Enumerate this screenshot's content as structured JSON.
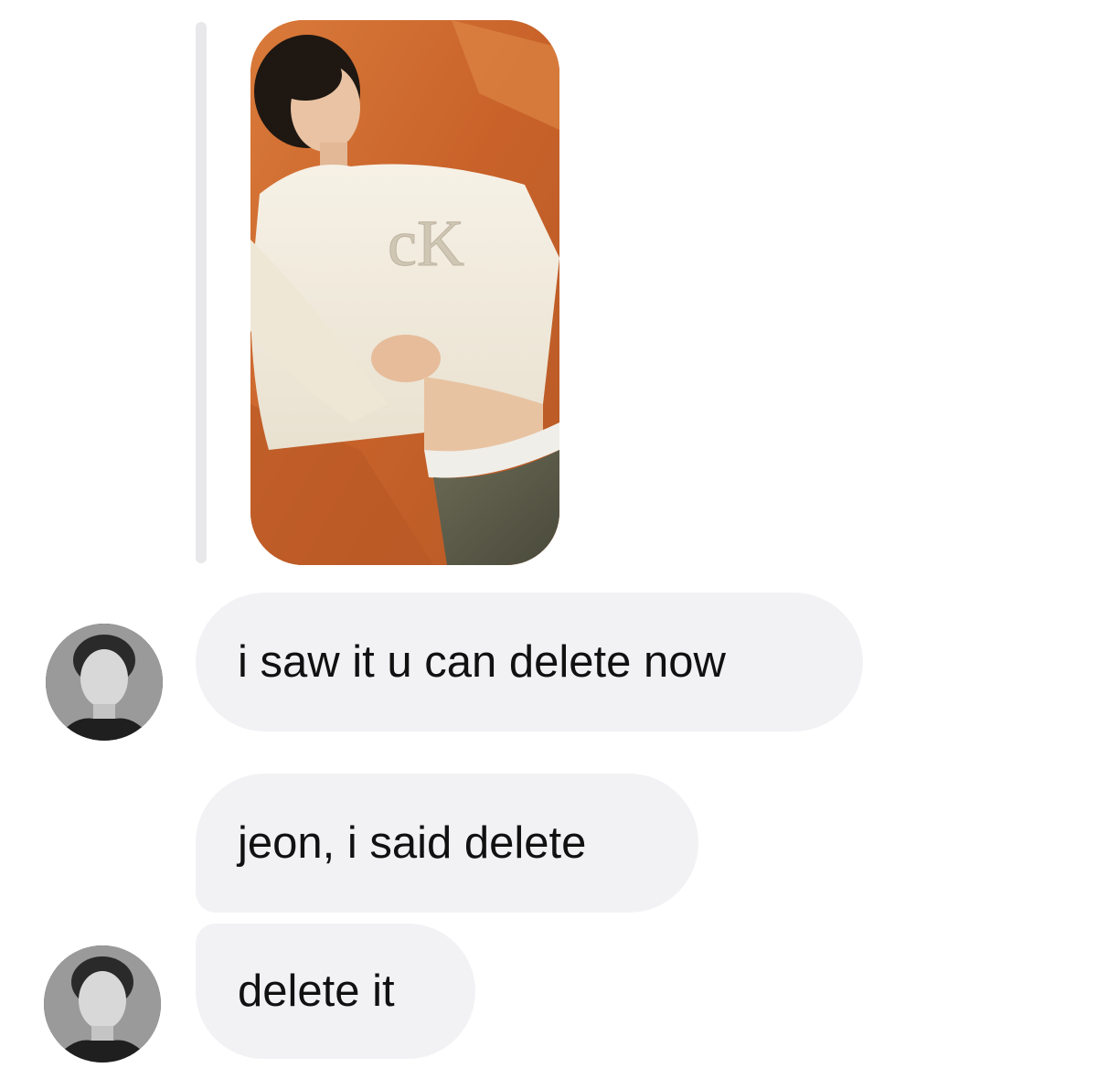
{
  "conversation": {
    "shared_photo": {
      "kind": "photo",
      "logo_text": "Calvin Klein"
    },
    "messages": [
      {
        "text": "i saw it u can delete now",
        "avatar": "contact-avatar"
      },
      {
        "text": "jeon, i said delete",
        "avatar": ""
      },
      {
        "text": "delete it",
        "avatar": "contact-avatar"
      }
    ]
  },
  "colors": {
    "bubble_bg": "#f2f2f5",
    "reply_bar": "#e8e8ea",
    "text": "#111111"
  }
}
